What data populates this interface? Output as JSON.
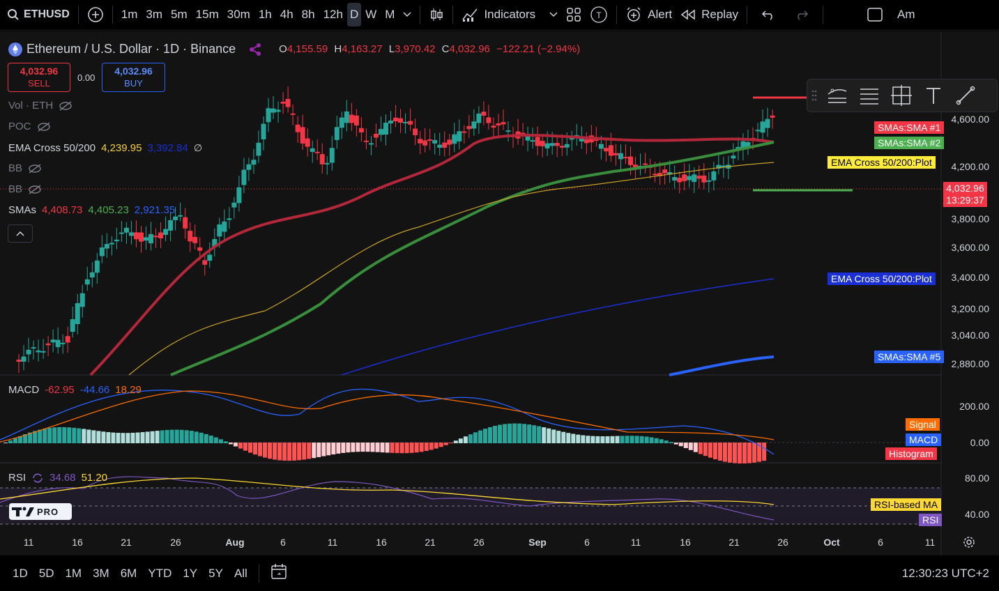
{
  "topbar": {
    "symbol": "ETHUSD",
    "intervals": [
      "1m",
      "3m",
      "5m",
      "15m",
      "30m",
      "1h",
      "4h",
      "8h",
      "12h",
      "D",
      "W",
      "M"
    ],
    "active_interval": "D",
    "indicators_label": "Indicators",
    "alert_label": "Alert",
    "replay_label": "Replay",
    "cut_label": "Am"
  },
  "header": {
    "title": "Ethereum / U.S. Dollar · 1D · Binance",
    "o_label": "O",
    "o_value": "4,155.59",
    "h_label": "H",
    "h_value": "4,163.27",
    "l_label": "L",
    "l_value": "3,970.42",
    "c_label": "C",
    "c_value": "4,032.96",
    "change": "−122.21 (−2.94%)"
  },
  "trade": {
    "sell_price": "4,032.96",
    "sell_label": "SELL",
    "spread": "0.00",
    "buy_price": "4,032.96",
    "buy_label": "BUY"
  },
  "legend": {
    "vol": "Vol · ETH",
    "poc": "POC",
    "ema_label": "EMA Cross 50/200",
    "ema_v1": "4,239.95",
    "ema_v2": "3,392.84",
    "bb1": "BB",
    "bb2": "BB",
    "smas_label": "SMAs",
    "sma_v1": "4,408.73",
    "sma_v2": "4,405.23",
    "sma_v3": "2,921.35"
  },
  "price_axis": [
    "4,600.00",
    "4,200.00",
    "3,800.00",
    "3,600.00",
    "3,400.00",
    "3,200.00",
    "3,040.00",
    "2,880.00"
  ],
  "tags": {
    "sma1": "SMAs:SMA #1",
    "sma2": "SMAs:SMA #2",
    "ema_plot1": "EMA Cross 50/200:Plot",
    "last_price": "4,032.96",
    "countdown": "13:29:37",
    "ema_plot2": "EMA Cross 50/200:Plot",
    "sma5": "SMAs:SMA #5"
  },
  "macd": {
    "label": "MACD",
    "v1": "-62.95",
    "v2": "-44.66",
    "v3": "18.29",
    "axis": [
      "200.00",
      "0.00"
    ],
    "signal": "Signal",
    "macd_tag": "MACD",
    "hist": "Histogram"
  },
  "rsi": {
    "label": "RSI",
    "v1": "34.68",
    "v2": "51.20",
    "axis": [
      "80.00",
      "40.00"
    ],
    "ma_tag": "RSI-based MA",
    "rsi_tag": "RSI"
  },
  "logo_text": "PRO",
  "dates": [
    "11",
    "16",
    "21",
    "26",
    "Aug",
    "6",
    "11",
    "16",
    "21",
    "26",
    "Sep",
    "6",
    "11",
    "16",
    "21",
    "26",
    "Oct",
    "6",
    "11"
  ],
  "bottombar": {
    "ranges": [
      "1D",
      "5D",
      "1M",
      "3M",
      "6M",
      "YTD",
      "1Y",
      "5Y",
      "All"
    ],
    "clock": "12:30:23 UTC+2"
  },
  "colors": {
    "up": "#26a69a",
    "down": "#f23645",
    "sma1": "#b2283a",
    "sma2": "#388e3c",
    "ema_fast": "#c9a227",
    "ema_slow": "#1a2fd6",
    "sma5": "#2962ff",
    "macd": "#2962ff",
    "signal": "#ff6d00",
    "rsi": "#7e57c2",
    "rsi_ma": "#fdd835"
  }
}
